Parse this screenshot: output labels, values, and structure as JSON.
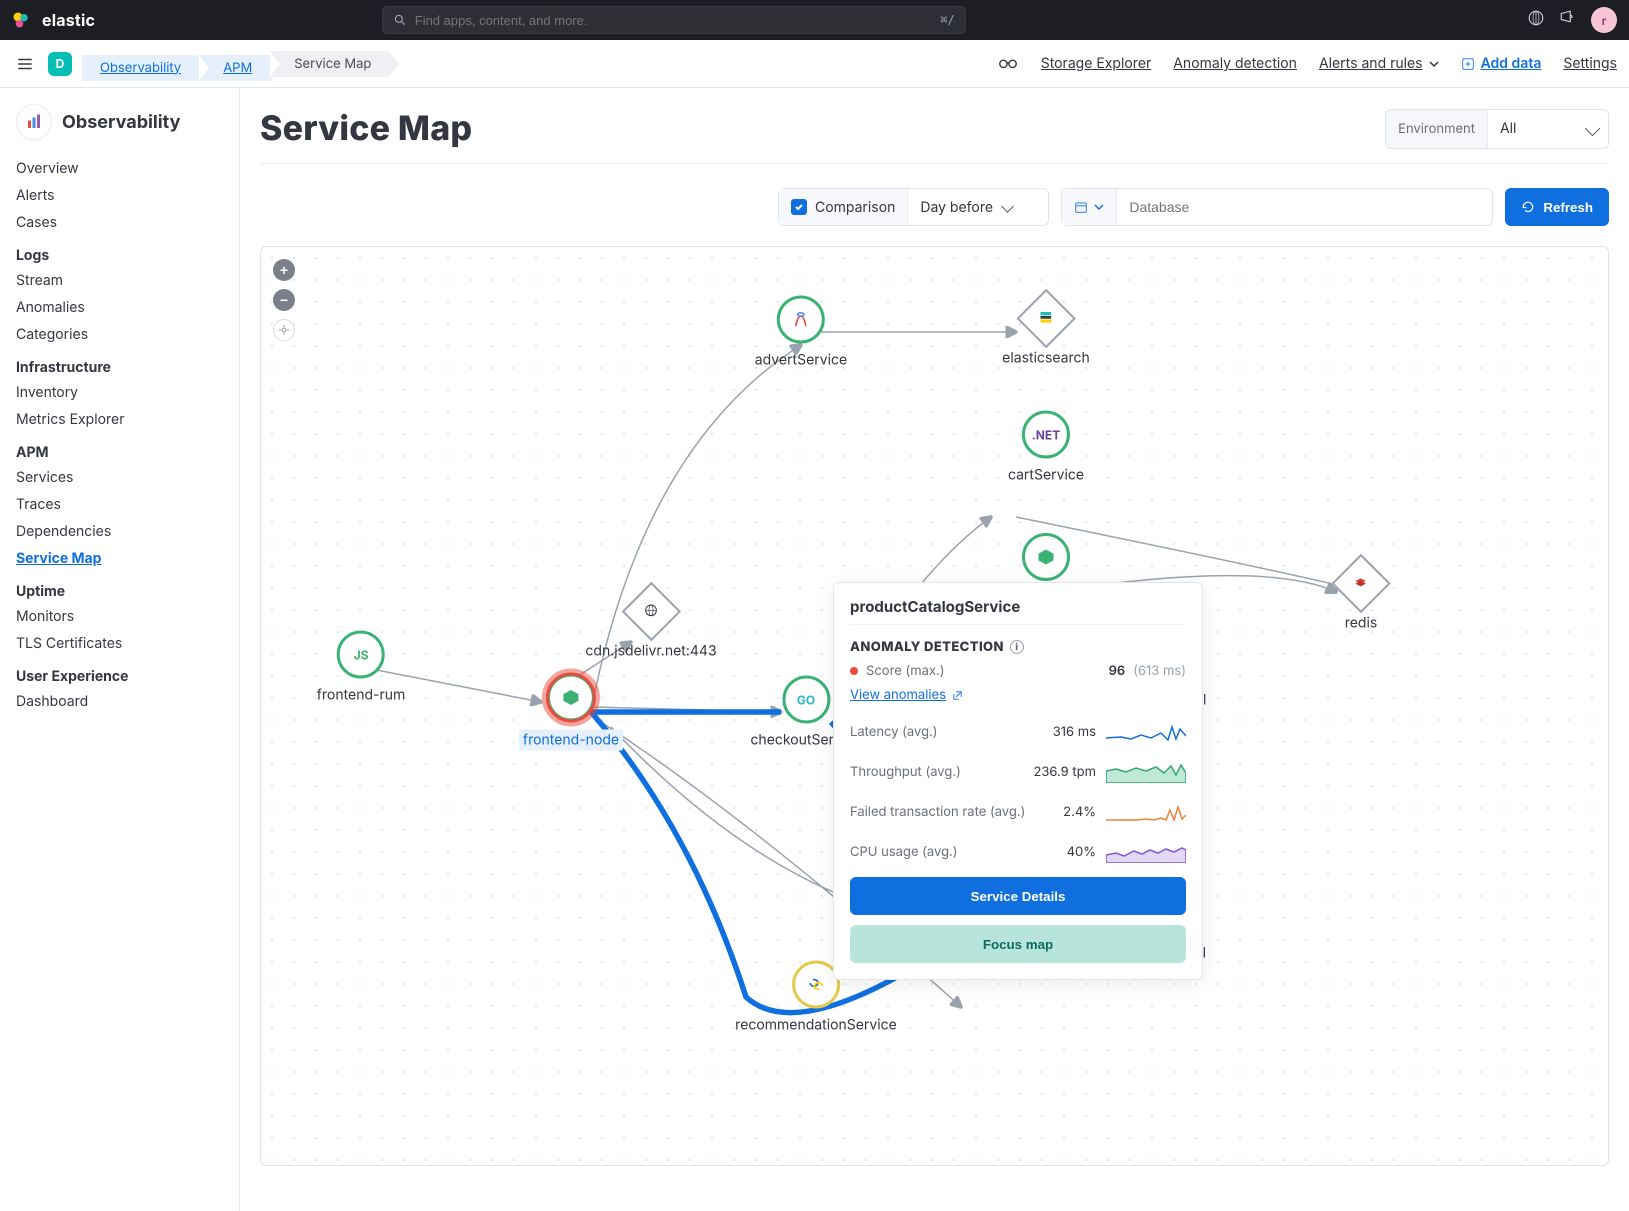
{
  "topbar": {
    "brand": "elastic",
    "search_placeholder": "Find apps, content, and more.",
    "kbd": "⌘/",
    "avatar_initial": "r"
  },
  "subbar": {
    "badge": "D",
    "crumbs": [
      "Observability",
      "APM",
      "Service Map"
    ],
    "right": {
      "storage": "Storage Explorer",
      "anomaly": "Anomaly detection",
      "alerts": "Alerts and rules",
      "add_data": "Add data",
      "settings": "Settings"
    }
  },
  "sidebar": {
    "title": "Observability",
    "top": [
      "Overview",
      "Alerts",
      "Cases"
    ],
    "groups": [
      {
        "heading": "Logs",
        "items": [
          "Stream",
          "Anomalies",
          "Categories"
        ]
      },
      {
        "heading": "Infrastructure",
        "items": [
          "Inventory",
          "Metrics Explorer"
        ]
      },
      {
        "heading": "APM",
        "items": [
          "Services",
          "Traces",
          "Dependencies",
          "Service Map"
        ],
        "active": "Service Map"
      },
      {
        "heading": "Uptime",
        "items": [
          "Monitors",
          "TLS Certificates"
        ]
      },
      {
        "heading": "User Experience",
        "items": [
          "Dashboard"
        ]
      }
    ]
  },
  "header": {
    "title": "Service Map",
    "env_label": "Environment",
    "env_value": "All"
  },
  "filters": {
    "comparison_label": "Comparison",
    "comparison_range": "Day before",
    "search_placeholder": "Database",
    "refresh": "Refresh"
  },
  "nodes": {
    "advert": "advertService",
    "elasticsearch": "elasticsearch",
    "cart": "cartService",
    "cart_icon": ".NET",
    "cdn": "cdn.jsdelivr.net:443",
    "frontend_rum": "frontend-rum",
    "frontend_rum_icon": "JS",
    "frontend_node": "frontend-node",
    "checkout": "checkoutService",
    "checkout_icon": "GO",
    "redis": "redis",
    "newsletter": "ewsletter-otel",
    "recommendation": "recommendationService",
    "product": "productCatalogService",
    "postgres": "postgresql"
  },
  "popover": {
    "title": "productCatalogService",
    "section": "ANOMALY DETECTION",
    "score_label": "Score (max.)",
    "score_value": "96",
    "score_range": "(613 ms)",
    "view_link": "View anomalies",
    "metrics": [
      {
        "label": "Latency (avg.)",
        "value": "316 ms",
        "color": "#0f6fde"
      },
      {
        "label": "Throughput (avg.)",
        "value": "236.9 tpm",
        "color": "#32a875"
      },
      {
        "label": "Failed transaction rate (avg.)",
        "value": "2.4%",
        "color": "#e8833a"
      },
      {
        "label": "CPU usage (avg.)",
        "value": "40%",
        "color": "#7e5bd6"
      }
    ],
    "btn_primary": "Service Details",
    "btn_secondary": "Focus map"
  }
}
